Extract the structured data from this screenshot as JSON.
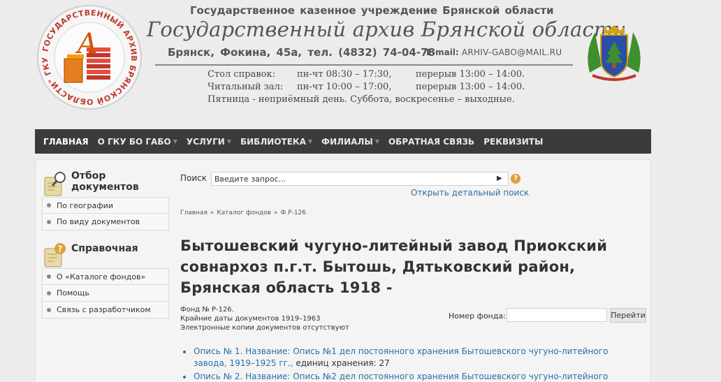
{
  "header": {
    "institution": "Государственное казенное учреждение Брянской области",
    "title": "Государственный архив Брянской области",
    "address": "Брянск, Фокина, 45а, тел. (4832) 74-04-78",
    "email_label": "E-mail:",
    "email_value": "ARHIV-GABO@MAIL.RU",
    "schedule": [
      {
        "name": "Стол справок:",
        "hours": "пн-чт 08:30 – 17:30,",
        "break": "перерыв 13:00 – 14:00."
      },
      {
        "name": "Читальный зал:",
        "hours": "пн-чт 10:00 – 17:00,",
        "break": "перерыв 13:00 – 14:00."
      }
    ],
    "schedule_note": "Пятница - неприёмный день. Суббота, воскресенье – выходные."
  },
  "nav": {
    "items": [
      {
        "label": "ГЛАВНАЯ",
        "active": true,
        "dropdown": false
      },
      {
        "label": "О ГКУ БО ГАБО",
        "active": false,
        "dropdown": true
      },
      {
        "label": "УСЛУГИ",
        "active": false,
        "dropdown": true
      },
      {
        "label": "БИБЛИОТЕКА",
        "active": false,
        "dropdown": true
      },
      {
        "label": "ФИЛИАЛЫ",
        "active": false,
        "dropdown": true
      },
      {
        "label": "ОБРАТНАЯ СВЯЗЬ",
        "active": false,
        "dropdown": false
      },
      {
        "label": "РЕКВИЗИТЫ",
        "active": false,
        "dropdown": false
      }
    ]
  },
  "sidebar": {
    "block1": {
      "title_line1": "Отбор",
      "title_line2": "документов",
      "items": [
        "По географии",
        "По виду документов"
      ]
    },
    "block2": {
      "title": "Справочная",
      "items": [
        "О «Каталоге фондов»",
        "Помощь",
        "Связь с разработчиком"
      ]
    }
  },
  "search": {
    "label": "Поиск",
    "value": "Введите запрос...",
    "go_glyph": "▶",
    "help_glyph": "?",
    "advanced_link": "Открыть детальный поиск"
  },
  "breadcrumb": [
    "Главная",
    "Каталог фондов",
    "Ф.Р-126"
  ],
  "breadcrumb_sep": "»",
  "page": {
    "title": "Бытошевский чугуно-литейный завод Приокский совнархоз п.г.т. Бытошь, Дятьковский район, Брянская область 1918 -",
    "fond_no": "Фонд № Р-126.",
    "dates": "Крайние даты документов 1919–1963",
    "copies": "Электронные копии документов отсутствуют"
  },
  "fond_search": {
    "label": "Номер фонда:",
    "button": "Перейти"
  },
  "opisi": [
    {
      "link": "Опись № 1. Название: Опись №1 дел постоянного хранения Бытошевского чугуно-литейного завода, 1919–1925 гг.,",
      "tail": " единиц хранения: 27"
    },
    {
      "link": "Опись № 2. Название: Опись №2 дел постоянного хранения Бытошевского чугуно-литейного",
      "tail": ""
    }
  ],
  "colors": {
    "nav_bg": "#3b3b3b",
    "link": "#2a6ea6",
    "seal_red": "#c0392b"
  }
}
